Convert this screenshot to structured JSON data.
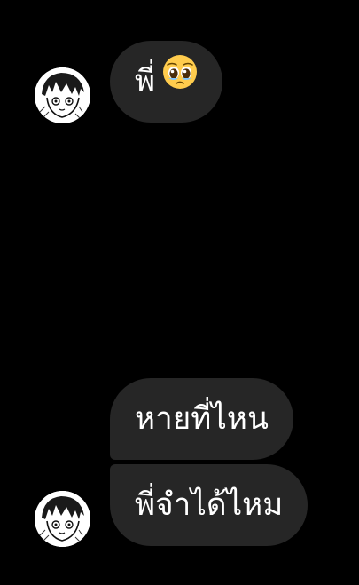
{
  "thread": {
    "messages": [
      {
        "text": "พี่",
        "emoji": "pleading-face-icon"
      },
      {
        "text": "หายที่ไหน"
      },
      {
        "text": "พี่จำได้ไหม"
      }
    ]
  },
  "theme": {
    "background": "#000000",
    "bubble": "#262626",
    "text": "#ffffff"
  }
}
